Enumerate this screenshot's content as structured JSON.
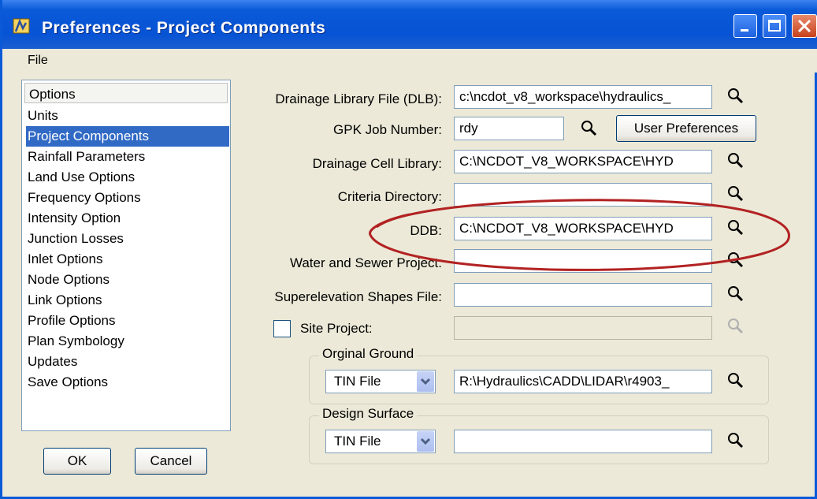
{
  "window": {
    "title": "Preferences - Project Components"
  },
  "menu": {
    "file": "File"
  },
  "sidebar": {
    "header": "Options",
    "items": [
      {
        "label": "Units"
      },
      {
        "label": "Project Components"
      },
      {
        "label": "Rainfall Parameters"
      },
      {
        "label": "Land Use Options"
      },
      {
        "label": "Frequency Options"
      },
      {
        "label": "Intensity Option"
      },
      {
        "label": "Junction Losses"
      },
      {
        "label": "Inlet Options"
      },
      {
        "label": "Node Options"
      },
      {
        "label": "Link Options"
      },
      {
        "label": "Profile Options"
      },
      {
        "label": "Plan Symbology"
      },
      {
        "label": "Updates"
      },
      {
        "label": "Save Options"
      }
    ],
    "selected_index": 1
  },
  "buttons": {
    "ok": "OK",
    "cancel": "Cancel",
    "user_prefs": "User Preferences"
  },
  "fields": {
    "dlb": {
      "label": "Drainage Library File (DLB):",
      "value": "c:\\ncdot_v8_workspace\\hydraulics_"
    },
    "gpk": {
      "label": "GPK Job Number:",
      "value": "rdy"
    },
    "cell": {
      "label": "Drainage Cell Library:",
      "value": "C:\\NCDOT_V8_WORKSPACE\\HYD"
    },
    "criteria": {
      "label": "Criteria Directory:",
      "value": ""
    },
    "ddb": {
      "label": "DDB:",
      "value": "C:\\NCDOT_V8_WORKSPACE\\HYD"
    },
    "water": {
      "label": "Water and Sewer Project:",
      "value": ""
    },
    "super": {
      "label": "Superelevation Shapes File:",
      "value": ""
    },
    "site": {
      "label": "Site Project:",
      "value": "",
      "checked": false
    }
  },
  "original_ground": {
    "title": "Orginal Ground",
    "type": "TIN File",
    "value": "R:\\Hydraulics\\CADD\\LIDAR\\r4903_"
  },
  "design_surface": {
    "title": "Design Surface",
    "type": "TIN File",
    "value": ""
  },
  "colors": {
    "title_bar": "#0a5ad8",
    "selection": "#316ac5",
    "annotation": "#b22222"
  }
}
